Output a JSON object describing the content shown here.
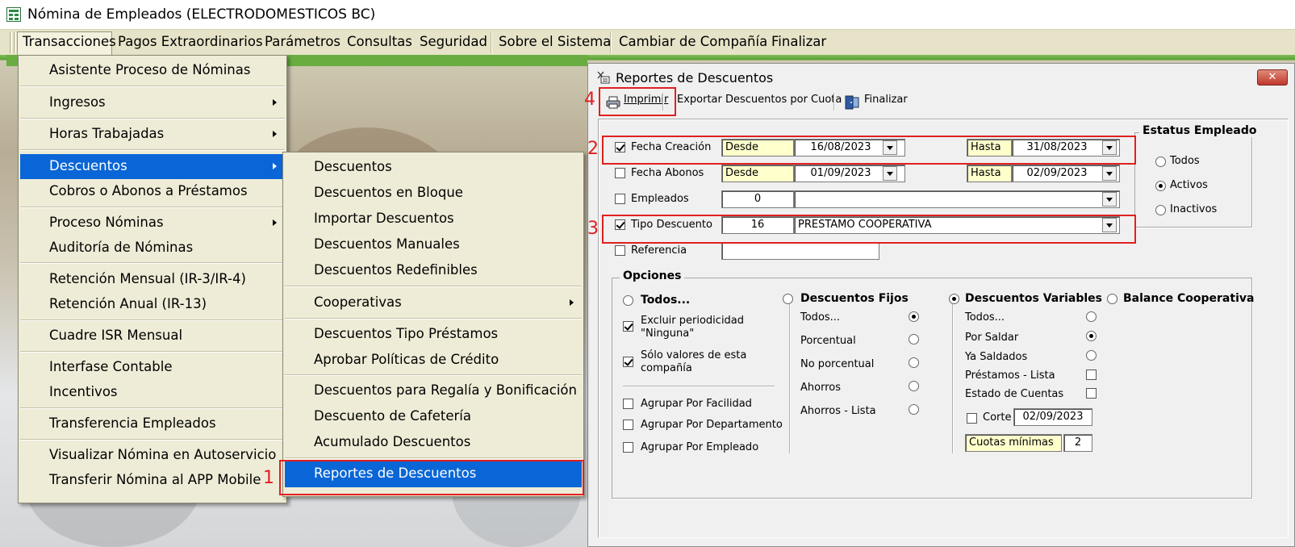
{
  "window": {
    "title": "Nómina de Empleados (ELECTRODOMESTICOS BC)"
  },
  "menubar": {
    "items": [
      "Transacciones",
      "Pagos Extraordinarios",
      "Parámetros",
      "Consultas",
      "Seguridad",
      "Sobre el Sistema",
      "Cambiar de Compañía",
      "Finalizar"
    ]
  },
  "transacciones_menu": {
    "items": [
      "Asistente Proceso de Nóminas",
      "Ingresos",
      "Horas Trabajadas",
      "Descuentos",
      "Cobros o Abonos a Préstamos",
      "Proceso Nóminas",
      "Auditoría de Nóminas",
      "Retención Mensual  (IR-3/IR-4)",
      "Retención Anual  (IR-13)",
      "Cuadre ISR Mensual",
      "Interfase Contable",
      "Incentivos",
      "Transferencia Empleados",
      "Visualizar Nómina en Autoservicio",
      "Transferir Nómina al APP Mobile"
    ]
  },
  "descuentos_menu": {
    "items": [
      "Descuentos",
      "Descuentos en Bloque",
      "Importar Descuentos",
      "Descuentos Manuales",
      "Descuentos Redefinibles",
      "Cooperativas",
      "Descuentos Tipo Préstamos",
      "Aprobar Políticas de Crédito",
      "Descuentos  para Regalía y Bonificación",
      "Descuento de Cafetería",
      "Acumulado Descuentos",
      "Reportes de Descuentos"
    ]
  },
  "annotations": [
    "1",
    "2",
    "3",
    "4"
  ],
  "dialog": {
    "title": "Reportes de Descuentos",
    "close": "✕",
    "toolbar": {
      "imprimir": "Imprimir",
      "exportar": "Exportar Descuentos por Cuota",
      "finalizar": "Finalizar"
    },
    "filters": {
      "fecha_creacion": {
        "label": "Fecha Creación",
        "checked": true,
        "desde_label": "Desde",
        "desde": "16/08/2023",
        "hasta_label": "Hasta",
        "hasta": "31/08/2023"
      },
      "fecha_abonos": {
        "label": "Fecha Abonos",
        "checked": false,
        "desde_label": "Desde",
        "desde": "01/09/2023",
        "hasta_label": "Hasta",
        "hasta": "02/09/2023"
      },
      "empleados": {
        "label": "Empleados",
        "checked": false,
        "code": "0",
        "name": ""
      },
      "tipo_descuento": {
        "label": "Tipo Descuento",
        "checked": true,
        "code": "16",
        "name": "PRESTAMO COOPERATIVA"
      },
      "referencia": {
        "label": "Referencia",
        "checked": false,
        "value": ""
      }
    },
    "estatus": {
      "title": "Estatus Empleado",
      "options": [
        "Todos",
        "Activos",
        "Inactivos"
      ],
      "selected": "Activos"
    },
    "opciones": {
      "title": "Opciones",
      "todos": "Todos...",
      "excluir": "Excluir periodicidad",
      "excluir2": "\"Ninguna\"",
      "solo": "Sólo valores de esta",
      "solo2": "compañía",
      "agrupar_facilidad": "Agrupar Por Facilidad",
      "agrupar_departamento": "Agrupar Por Departamento",
      "agrupar_empleado": "Agrupar Por Empleado",
      "fijos": {
        "title": "Descuentos Fijos",
        "items": [
          "Todos...",
          "Porcentual",
          "No porcentual",
          "Ahorros",
          "Ahorros - Lista"
        ]
      },
      "variables": {
        "title": "Descuentos Variables",
        "items": [
          "Todos...",
          "Por Saldar",
          "Ya Saldados",
          "Préstamos - Lista",
          "Estado de Cuentas"
        ],
        "corte_label": "Corte",
        "corte_value": "02/09/2023",
        "cuotas_label": "Cuotas mínimas",
        "cuotas_value": "2"
      },
      "balance": "Balance Cooperativa"
    }
  }
}
